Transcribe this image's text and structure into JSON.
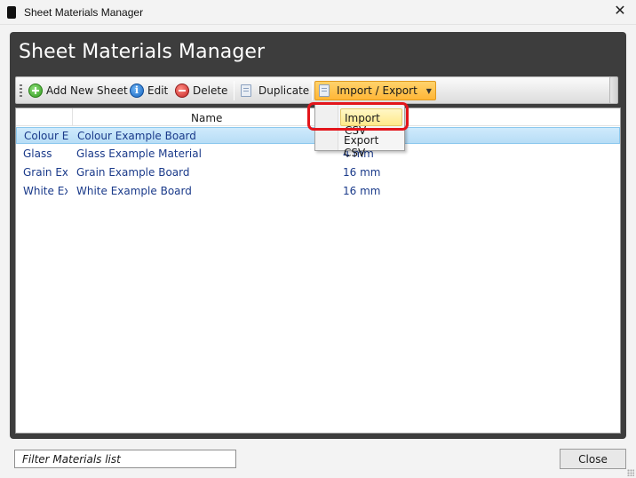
{
  "window": {
    "title": "Sheet Materials Manager",
    "close_glyph": "✕"
  },
  "header": {
    "title": "Sheet Materials Manager"
  },
  "toolbar": {
    "add_label": "Add New Sheet",
    "edit_label": "Edit",
    "delete_label": "Delete",
    "duplicate_label": "Duplicate",
    "import_export_label": "Import / Export",
    "info_glyph": "i",
    "caret_glyph": "▼"
  },
  "table": {
    "columns": [
      "",
      "Name",
      ""
    ],
    "rows": [
      {
        "code": "Colour Ex",
        "name": "Colour Example Board",
        "thickness": "",
        "selected": true
      },
      {
        "code": "Glass",
        "name": "Glass Example Material",
        "thickness": "4 mm",
        "selected": false
      },
      {
        "code": "Grain Ex",
        "name": "Grain Example Board",
        "thickness": "16 mm",
        "selected": false
      },
      {
        "code": "White Ex",
        "name": "White Example Board",
        "thickness": "16 mm",
        "selected": false
      }
    ]
  },
  "dropdown": {
    "items": [
      "Import CSV",
      "Export CSV"
    ],
    "highlighted": "Import CSV"
  },
  "footer": {
    "filter_placeholder": "Filter Materials list",
    "close_label": "Close"
  },
  "colors": {
    "panel_bg": "#3d3d3d",
    "selection": "#b7ddf6",
    "active_button": "#ffb637",
    "highlight_ring": "#e3151b"
  },
  "icons": {
    "add": "add-circle-icon",
    "edit": "info-icon",
    "delete": "delete-circle-icon",
    "duplicate": "document-copy-icon",
    "import_export": "document-icon"
  }
}
